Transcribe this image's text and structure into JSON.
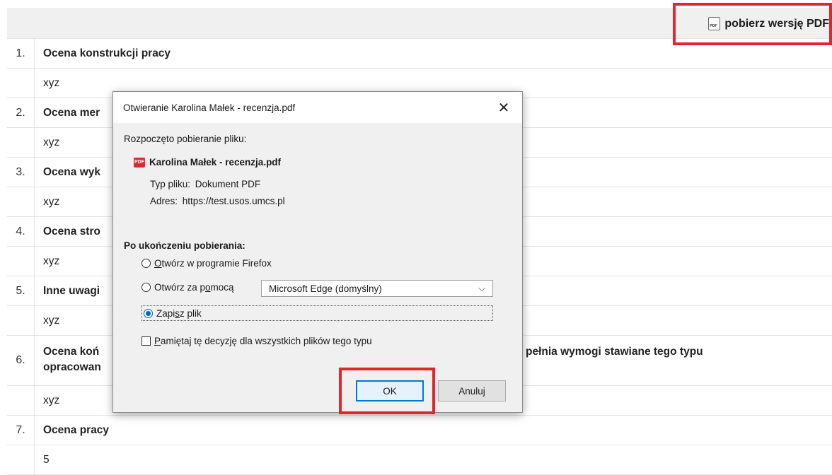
{
  "header": {
    "pdf_link_label": "pobierz wersję PDF"
  },
  "rows": [
    {
      "num": "1.",
      "question": "Ocena konstrukcji pracy",
      "answer": "xyz"
    },
    {
      "num": "2.",
      "question": "Ocena mer",
      "answer": "xyz"
    },
    {
      "num": "3.",
      "question": "Ocena wyk",
      "answer": "xyz"
    },
    {
      "num": "4.",
      "question": "Ocena stro",
      "answer": "xyz"
    },
    {
      "num": "5.",
      "question": "Inne uwagi",
      "answer": "xyz"
    },
    {
      "num": "6.",
      "question_line1_left": "Ocena koń",
      "question_line1_right": "pełnia wymogi stawiane tego typu",
      "question_line2": "opracowan",
      "answer": "xyz"
    },
    {
      "num": "7.",
      "question": "Ocena pracy",
      "answer": "5"
    }
  ],
  "dialog": {
    "title": "Otwieranie Karolina Małek - recenzja.pdf",
    "intro": "Rozpoczęto pobieranie pliku:",
    "file_icon_text": "PDF",
    "file_name": "Karolina Małek - recenzja.pdf",
    "file_type_label": "Typ pliku:",
    "file_type_value": "Dokument PDF",
    "address_label": "Adres:",
    "address_value": "https://test.usos.umcs.pl",
    "after_download_label": "Po ukończeniu pobierania:",
    "option_open_firefox": {
      "underlined": "O",
      "rest": "twórz w programie Firefox"
    },
    "option_open_with": {
      "before": "Otwórz za p",
      "underlined": "o",
      "after": "mocą"
    },
    "app_select_value": "Microsoft Edge (domyślny)",
    "option_save": {
      "before": "Zapi",
      "underlined": "s",
      "after": "z plik"
    },
    "remember_checkbox": {
      "underlined": "P",
      "rest": "amiętaj tę decyzję dla wszystkich plików tego typu"
    },
    "ok_label": "OK",
    "cancel_label": "Anuluj",
    "close_glyph": "✕",
    "select_arrow_glyph": "⌵"
  },
  "colors": {
    "highlight": "#e3262b",
    "accent": "#0078d7"
  }
}
